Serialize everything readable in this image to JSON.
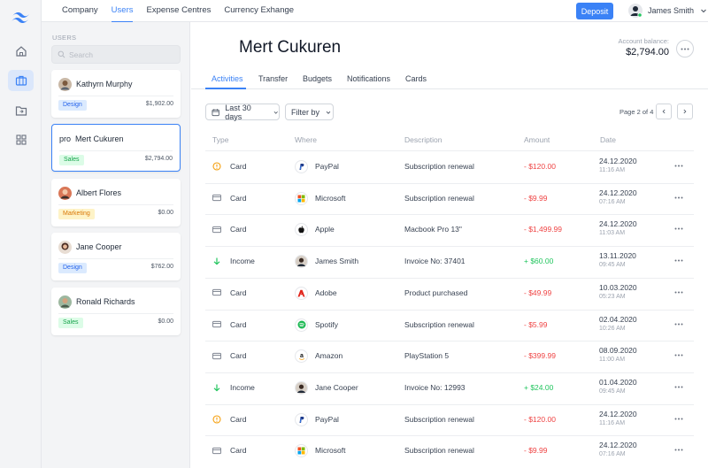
{
  "topnav": [
    "Company",
    "Users",
    "Expense Centres",
    "Currency Exhange"
  ],
  "deposit_label": "Deposit",
  "current_user": "James Smith",
  "users_title": "USERS",
  "search_placeholder": "Search",
  "users": [
    {
      "name": "Kathyrn Murphy",
      "tag": "Design",
      "amount": "$1,902.00",
      "avatar": "photo"
    },
    {
      "name": "Mert Cukuren",
      "prefix": "pro",
      "tag": "Sales",
      "amount": "$2,794.00",
      "selected": true
    },
    {
      "name": "Albert Flores",
      "tag": "Marketing",
      "amount": "$0.00",
      "avatar": "photo"
    },
    {
      "name": "Jane Cooper",
      "tag": "Design",
      "amount": "$762.00",
      "avatar": "photo"
    },
    {
      "name": "Ronald Richards",
      "tag": "Sales",
      "amount": "$0.00",
      "avatar": "photo"
    }
  ],
  "tag_colors": {
    "Design": {
      "bg": "#dbeafe",
      "fg": "#2563eb"
    },
    "Sales": {
      "bg": "#dcfce7",
      "fg": "#16a34a"
    },
    "Marketing": {
      "bg": "#fef3c7",
      "fg": "#d97706"
    }
  },
  "profile": {
    "name": "Mert Cukuren",
    "balance_label": "Account balance:",
    "balance": "$2,794.00"
  },
  "tabs": [
    "Activities",
    "Transfer",
    "Budgets",
    "Notifications",
    "Cards"
  ],
  "filters": {
    "period": "Last 30 days",
    "filter_by": "Filter by"
  },
  "pagination": "Page 2 of 4",
  "columns": [
    "Type",
    "Where",
    "Description",
    "Amount",
    "Date"
  ],
  "transactions": [
    {
      "type": "Card",
      "type_icon": "pending-icon",
      "where": "PayPal",
      "where_icon": "paypal-icon",
      "description": "Subscription renewal",
      "amount": "- $120.00",
      "date": "24.12.2020",
      "time": "11:16 AM"
    },
    {
      "type": "Card",
      "type_icon": "card-icon",
      "where": "Microsoft",
      "where_icon": "microsoft-icon",
      "description": "Subscription renewal",
      "amount": "- $9.99",
      "date": "24.12.2020",
      "time": "07:16 AM"
    },
    {
      "type": "Card",
      "type_icon": "card-icon",
      "where": "Apple",
      "where_icon": "apple-icon",
      "description": "Macbook Pro 13\"",
      "amount": "- $1,499.99",
      "date": "24.12.2020",
      "time": "11:03 AM"
    },
    {
      "type": "Income",
      "type_icon": "income-arrow-icon",
      "where": "James Smith",
      "where_icon": "person-avatar-icon",
      "description": "Invoice No: 37401",
      "amount": "+ $60.00",
      "date": "13.11.2020",
      "time": "09:45 AM"
    },
    {
      "type": "Card",
      "type_icon": "card-icon",
      "where": "Adobe",
      "where_icon": "adobe-icon",
      "description": "Product purchased",
      "amount": "- $49.99",
      "date": "10.03.2020",
      "time": "05:23 AM"
    },
    {
      "type": "Card",
      "type_icon": "card-icon",
      "where": "Spotify",
      "where_icon": "spotify-icon",
      "description": "Subscription renewal",
      "amount": "- $5.99",
      "date": "02.04.2020",
      "time": "10:26 AM"
    },
    {
      "type": "Card",
      "type_icon": "card-icon",
      "where": "Amazon",
      "where_icon": "amazon-icon",
      "description": "PlayStation 5",
      "amount": "- $399.99",
      "date": "08.09.2020",
      "time": "11:00 AM"
    },
    {
      "type": "Income",
      "type_icon": "income-arrow-icon",
      "where": "Jane Cooper",
      "where_icon": "person-avatar-icon",
      "description": "Invoice No: 12993",
      "amount": "+ $24.00",
      "date": "01.04.2020",
      "time": "09:45 AM"
    },
    {
      "type": "Card",
      "type_icon": "pending-icon",
      "where": "PayPal",
      "where_icon": "paypal-icon",
      "description": "Subscription renewal",
      "amount": "- $120.00",
      "date": "24.12.2020",
      "time": "11:16 AM"
    },
    {
      "type": "Card",
      "type_icon": "card-icon",
      "where": "Microsoft",
      "where_icon": "microsoft-icon",
      "description": "Subscription renewal",
      "amount": "- $9.99",
      "date": "24.12.2020",
      "time": "07:16 AM"
    }
  ],
  "colors": {
    "accent": "#3b82f6",
    "negative": "#ef4444",
    "positive": "#22c55e"
  }
}
